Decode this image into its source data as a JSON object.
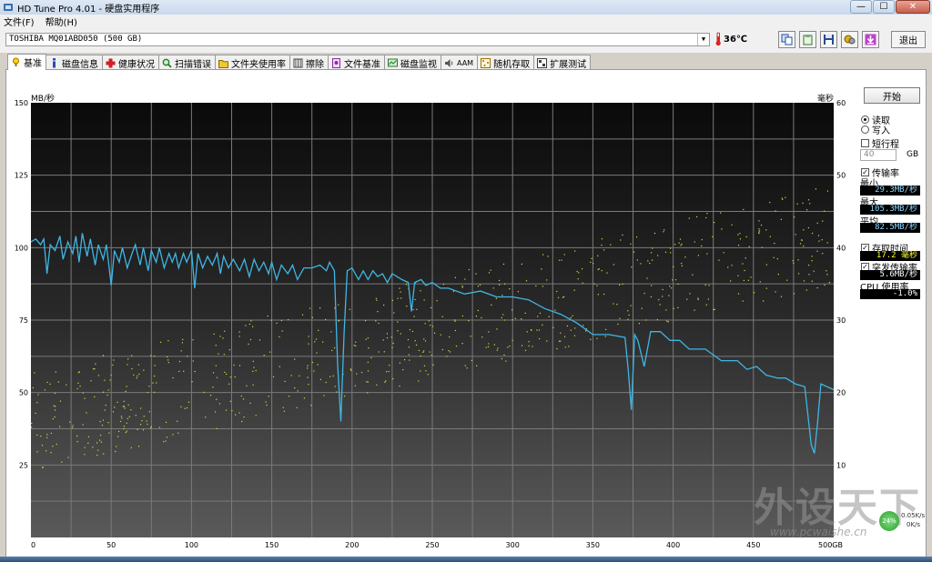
{
  "window": {
    "title": "HD Tune Pro 4.01 - 硬盘实用程序",
    "min": "—",
    "max": "☐",
    "close": "✕"
  },
  "menu": [
    "文件(F)",
    "帮助(H)"
  ],
  "toolbar": {
    "drive": "TOSHIBA MQ01ABD050 (500 GB)",
    "temperature": "36℃",
    "exit_label": "退出"
  },
  "tabs": [
    {
      "label": "基准",
      "icon": "benchmark-icon",
      "color": "#d8a000"
    },
    {
      "label": "磁盘信息",
      "icon": "info-icon",
      "color": "#2050b0"
    },
    {
      "label": "健康状况",
      "icon": "health-cross-icon",
      "color": "#d02020"
    },
    {
      "label": "扫描错误",
      "icon": "magnifier-icon",
      "color": "#2a7a2a"
    },
    {
      "label": "文件夹使用率",
      "icon": "folder-icon",
      "color": "#d8b000"
    },
    {
      "label": "擦除",
      "icon": "erase-icon",
      "color": "#555555"
    },
    {
      "label": "文件基准",
      "icon": "file-benchmark-icon",
      "color": "#8a2aa0"
    },
    {
      "label": "磁盘监视",
      "icon": "disk-monitor-icon",
      "color": "#2a8a2a"
    },
    {
      "label": "AAM",
      "icon": "speaker-icon",
      "color": "#555555"
    },
    {
      "label": "随机存取",
      "icon": "random-access-icon",
      "color": "#c08000"
    },
    {
      "label": "扩展测试",
      "icon": "extended-test-icon",
      "color": "#404040"
    }
  ],
  "side": {
    "start_label": "开始",
    "read_label": "读取",
    "write_label": "写入",
    "short_stroke_label": "短行程",
    "short_stroke_value": "40",
    "short_stroke_unit": "GB",
    "transfer_label": "传输率",
    "min_label": "最小",
    "min_value": "29.3MB/秒",
    "max_label": "最大",
    "max_value": "105.3MB/秒",
    "avg_label": "平均",
    "avg_value": "82.5MB/秒",
    "access_label": "存取时间",
    "access_value": "17.2 毫秒",
    "burst_label": "突发传输率",
    "burst_value": "5.6MB/秒",
    "cpu_label": "CPU 使用率",
    "cpu_value": "-1.0%"
  },
  "overlay": {
    "watermark": "外设天下",
    "url": "www.pcwaishe.cn",
    "net_percent": "24%",
    "net_up": "0.05K/s",
    "net_down": "0K/s"
  },
  "chart_data": {
    "type": "line",
    "y_left_label": "MB/秒",
    "y_right_label": "毫秒",
    "ylim_left": [
      0,
      150
    ],
    "ylim_right": [
      0,
      60
    ],
    "xlim": [
      0,
      500
    ],
    "x_ticks": [
      "0",
      "50",
      "100",
      "150",
      "200",
      "250",
      "300",
      "350",
      "400",
      "450",
      "500GB"
    ],
    "y_left_ticks": [
      "150",
      "125",
      "100",
      "75",
      "50",
      "25"
    ],
    "y_right_ticks": [
      "60",
      "50",
      "40",
      "30",
      "20",
      "10"
    ],
    "grid": true,
    "line_color": "#3fb6e6",
    "dot_color": "#d8d840",
    "series": [
      {
        "values": [
          [
            0,
            102
          ],
          [
            3,
            103
          ],
          [
            6,
            101
          ],
          [
            8,
            103
          ],
          [
            10,
            91
          ],
          [
            12,
            101
          ],
          [
            15,
            99
          ],
          [
            18,
            104
          ],
          [
            20,
            96
          ],
          [
            23,
            102
          ],
          [
            26,
            98
          ],
          [
            28,
            104
          ],
          [
            30,
            95
          ],
          [
            32,
            105
          ],
          [
            35,
            97
          ],
          [
            37,
            103
          ],
          [
            40,
            94
          ],
          [
            42,
            101
          ],
          [
            45,
            96
          ],
          [
            47,
            101
          ],
          [
            50,
            87
          ],
          [
            52,
            99
          ],
          [
            55,
            95
          ],
          [
            57,
            100
          ],
          [
            60,
            93
          ],
          [
            63,
            98
          ],
          [
            65,
            101
          ],
          [
            68,
            94
          ],
          [
            70,
            100
          ],
          [
            73,
            92
          ],
          [
            75,
            99
          ],
          [
            78,
            95
          ],
          [
            80,
            100
          ],
          [
            83,
            93
          ],
          [
            86,
            98
          ],
          [
            88,
            95
          ],
          [
            90,
            98
          ],
          [
            92,
            93
          ],
          [
            95,
            98
          ],
          [
            97,
            95
          ],
          [
            100,
            99
          ],
          [
            102,
            86
          ],
          [
            104,
            98
          ],
          [
            107,
            93
          ],
          [
            110,
            97
          ],
          [
            113,
            94
          ],
          [
            116,
            98
          ],
          [
            118,
            91
          ],
          [
            120,
            97
          ],
          [
            123,
            93
          ],
          [
            126,
            96
          ],
          [
            130,
            92
          ],
          [
            133,
            96
          ],
          [
            136,
            90
          ],
          [
            139,
            96
          ],
          [
            142,
            92
          ],
          [
            145,
            95
          ],
          [
            148,
            91
          ],
          [
            150,
            95
          ],
          [
            153,
            89
          ],
          [
            156,
            94
          ],
          [
            160,
            91
          ],
          [
            163,
            94
          ],
          [
            166,
            89
          ],
          [
            170,
            93
          ],
          [
            175,
            93
          ],
          [
            180,
            94
          ],
          [
            184,
            92
          ],
          [
            186,
            95
          ],
          [
            189,
            92
          ],
          [
            191,
            60
          ],
          [
            193,
            40
          ],
          [
            195,
            70
          ],
          [
            197,
            92
          ],
          [
            200,
            93
          ],
          [
            204,
            89
          ],
          [
            207,
            92
          ],
          [
            210,
            89
          ],
          [
            213,
            92
          ],
          [
            216,
            90
          ],
          [
            219,
            91
          ],
          [
            222,
            88
          ],
          [
            225,
            91
          ],
          [
            228,
            90
          ],
          [
            231,
            89
          ],
          [
            235,
            88
          ],
          [
            237,
            78
          ],
          [
            239,
            88
          ],
          [
            243,
            89
          ],
          [
            246,
            87
          ],
          [
            250,
            88
          ],
          [
            255,
            86
          ],
          [
            260,
            86
          ],
          [
            270,
            84
          ],
          [
            280,
            85
          ],
          [
            290,
            83
          ],
          [
            300,
            83
          ],
          [
            310,
            82
          ],
          [
            320,
            79
          ],
          [
            330,
            77
          ],
          [
            340,
            74
          ],
          [
            350,
            70
          ],
          [
            360,
            70
          ],
          [
            370,
            69
          ],
          [
            372,
            58
          ],
          [
            374,
            44
          ],
          [
            376,
            70
          ],
          [
            378,
            68
          ],
          [
            382,
            59
          ],
          [
            386,
            71
          ],
          [
            392,
            71
          ],
          [
            398,
            68
          ],
          [
            404,
            68
          ],
          [
            410,
            65
          ],
          [
            420,
            65
          ],
          [
            430,
            61
          ],
          [
            440,
            61
          ],
          [
            446,
            58
          ],
          [
            452,
            59
          ],
          [
            458,
            56
          ],
          [
            465,
            55
          ],
          [
            470,
            55
          ],
          [
            476,
            53
          ],
          [
            482,
            52
          ],
          [
            486,
            32
          ],
          [
            488,
            29
          ],
          [
            490,
            40
          ],
          [
            492,
            53
          ],
          [
            496,
            52
          ],
          [
            500,
            51
          ]
        ]
      }
    ]
  }
}
